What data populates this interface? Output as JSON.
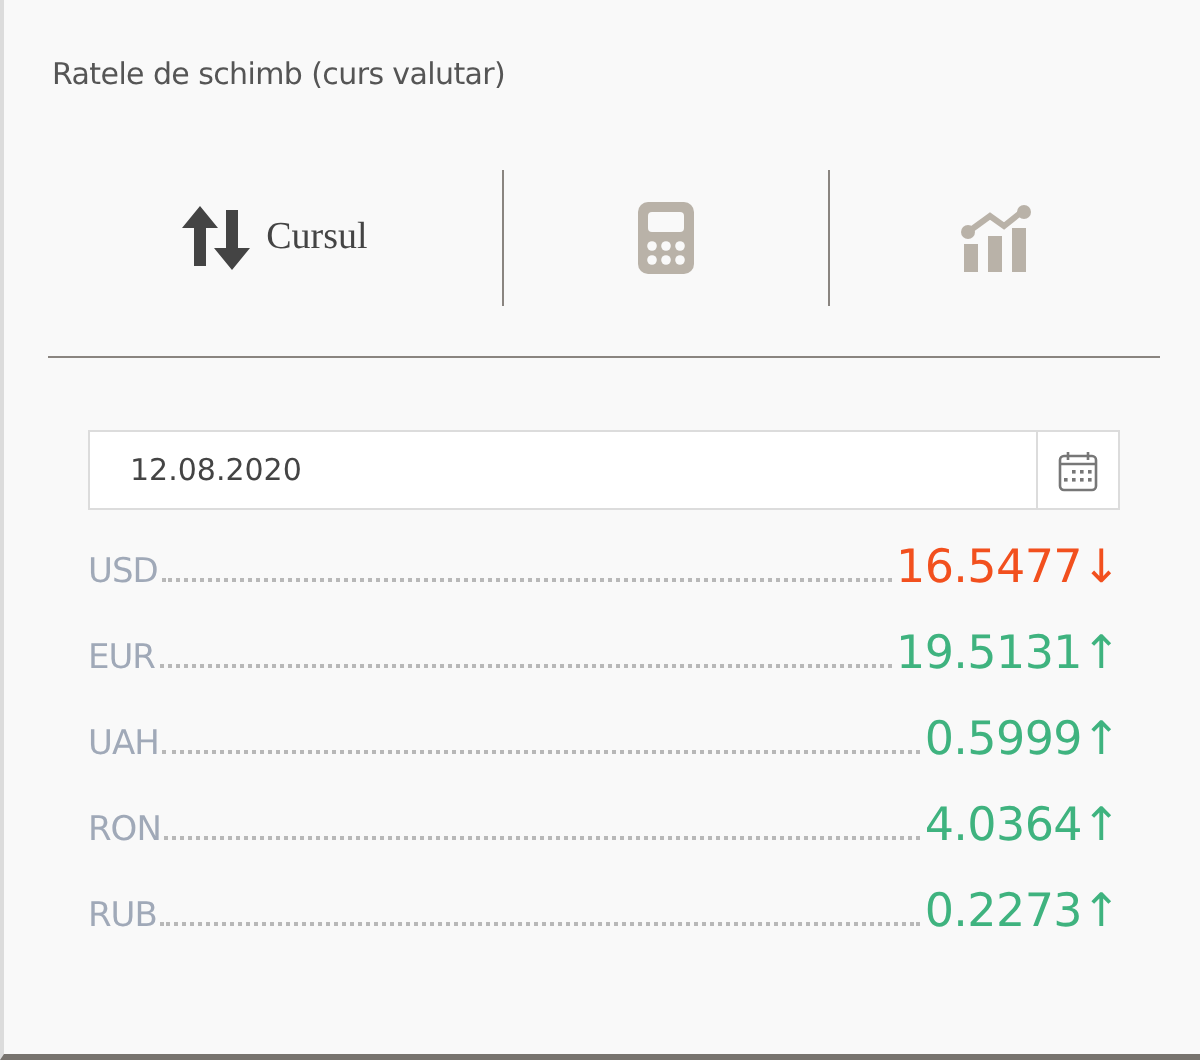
{
  "title": "Ratele de schimb (curs valutar)",
  "tabs": [
    {
      "kind": "rates",
      "label": "Cursul",
      "selected": true
    },
    {
      "kind": "calculator",
      "selected": false
    },
    {
      "kind": "chart",
      "selected": false
    }
  ],
  "date_field": {
    "value": "12.08.2020"
  },
  "rates": [
    {
      "code": "USD",
      "value": "16.5477",
      "arrow": "↓",
      "kind": "down"
    },
    {
      "code": "EUR",
      "value": "19.5131",
      "arrow": "↑",
      "kind": "up"
    },
    {
      "code": "UAH",
      "value": "0.5999",
      "arrow": "↑",
      "kind": "up"
    },
    {
      "code": "RON",
      "value": "4.0364",
      "arrow": "↑",
      "kind": "up"
    },
    {
      "code": "RUB",
      "value": "0.2273",
      "arrow": "↑",
      "kind": "up"
    }
  ]
}
